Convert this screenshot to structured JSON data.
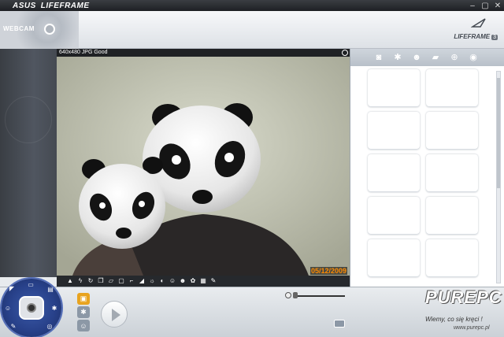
{
  "titlebar": {
    "brand1": "ASUS",
    "brand2": "LIFEFRAME"
  },
  "header": {
    "webcam_label": "WEBCAM",
    "logo_text": "LIFEFRAME",
    "logo_num": "3"
  },
  "preview": {
    "info": "640x480 JPG Good",
    "date_overlay": "05/12/2009"
  },
  "tabs": [
    {
      "name": "camera-icon",
      "glyph": "◙"
    },
    {
      "name": "gear-icon",
      "glyph": "✱"
    },
    {
      "name": "face-icon",
      "glyph": "☻"
    },
    {
      "name": "video-icon",
      "glyph": "▰"
    },
    {
      "name": "microphone-icon",
      "glyph": "⊕"
    },
    {
      "name": "eye-icon",
      "glyph": "◉"
    }
  ],
  "tools": [
    {
      "name": "landscape-icon",
      "glyph": "▲"
    },
    {
      "name": "flash-icon",
      "glyph": "ϟ"
    },
    {
      "name": "timer-icon",
      "glyph": "↻"
    },
    {
      "name": "multi-frame-icon",
      "glyph": "❐"
    },
    {
      "name": "ruler-icon",
      "glyph": "▱"
    },
    {
      "name": "frame-icon",
      "glyph": "▢"
    },
    {
      "name": "crop-icon",
      "glyph": "⌐"
    },
    {
      "name": "brightness-ramp-icon",
      "glyph": "◢"
    },
    {
      "name": "sun-icon",
      "glyph": "☼"
    },
    {
      "name": "contrast-icon",
      "glyph": "◐"
    },
    {
      "name": "face-mask-icon",
      "glyph": "☺"
    },
    {
      "name": "emoticon-icon",
      "glyph": "☻"
    },
    {
      "name": "color-icon",
      "glyph": "✿"
    },
    {
      "name": "image-adjust-icon",
      "glyph": "▦"
    },
    {
      "name": "wrench-icon",
      "glyph": "✎"
    }
  ],
  "thumbnail_count": 10,
  "watermark": {
    "logo": "PUREPC",
    "slogan": "Wiemy, co się kręci !",
    "site": "www.purepc.pl"
  },
  "colors": {
    "date": "#ff8a00",
    "dial": "#28418a",
    "record": "#e8a31f"
  }
}
